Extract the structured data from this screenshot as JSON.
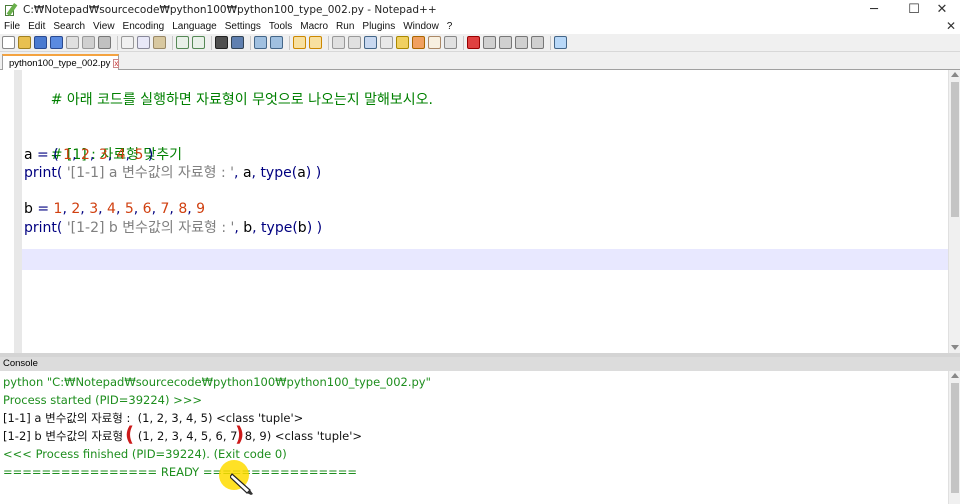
{
  "window": {
    "title": "C:₩Notepad₩sourcecode₩python100₩python100_type_002.py - Notepad++",
    "controls": {
      "minimize": "─",
      "maximize": "☐",
      "close": "✕"
    }
  },
  "menu": {
    "items": [
      "File",
      "Edit",
      "Search",
      "View",
      "Encoding",
      "Language",
      "Settings",
      "Tools",
      "Macro",
      "Run",
      "Plugins",
      "Window",
      "?"
    ],
    "close_glyph": "✕"
  },
  "tabs": [
    {
      "label": "python100_type_002.py",
      "active": true,
      "close_glyph": "x"
    }
  ],
  "editor": {
    "lines": [
      {
        "type": "comment",
        "text": "# 아래 코드를 실행하면 자료형이 무엇으로 나오는지 말해보시오."
      },
      {
        "type": "blank",
        "text": ""
      },
      {
        "type": "blank",
        "text": ""
      },
      {
        "type": "comment",
        "text": "# [1] : 자료형 맞추기"
      },
      {
        "type": "assign_a",
        "var": "a",
        "eq": "=",
        "lparen": "(",
        "nums": [
          "1",
          "2",
          "3",
          "4",
          "5"
        ],
        "rparen": ")"
      },
      {
        "type": "print_a",
        "fn": "print",
        "str": "'[1-1] a 변수값의 자료형 : '",
        "arg": "a",
        "type_fn": "type",
        "type_arg": "a"
      },
      {
        "type": "blank",
        "text": ""
      },
      {
        "type": "assign_b",
        "var": "b",
        "eq": "=",
        "nums": [
          "1",
          "2",
          "3",
          "4",
          "5",
          "6",
          "7",
          "8",
          "9"
        ]
      },
      {
        "type": "print_b",
        "fn": "print",
        "str": "'[1-2] b 변수값의 자료형 : '",
        "arg": "b",
        "type_fn": "type",
        "type_arg": "b"
      }
    ]
  },
  "console": {
    "header": "Console",
    "lines": [
      {
        "text": "python \"C:₩Notepad₩sourcecode₩python100₩python100_type_002.py\"",
        "color": "green"
      },
      {
        "text": "Process started (PID=39224) >>>",
        "color": "green"
      },
      {
        "text": "[1-1] a 변수값의 자료형 :  (1, 2, 3, 4, 5) <class 'tuple'>",
        "color": "black"
      },
      {
        "text": "[1-2] b 변수값의 자료형 :  (1, 2, 3, 4, 5, 6, 7, 8, 9) <class 'tuple'>",
        "color": "black"
      },
      {
        "text": "<<< Process finished (PID=39224). (Exit code 0)",
        "color": "green"
      },
      {
        "text": "================ READY ================",
        "color": "green"
      }
    ]
  },
  "annotations": {
    "left_paren": "(",
    "right_paren": ")",
    "mark_color": "#cc1a1a",
    "cursor_highlight_color": "#ffdc00"
  },
  "colors": {
    "comment": "#008000",
    "keyword": "#000080",
    "number": "#d04010",
    "string": "#808080",
    "console_green": "#1e8e1e",
    "current_line": "#e8e8ff",
    "tab_accent": "#f4a340"
  }
}
